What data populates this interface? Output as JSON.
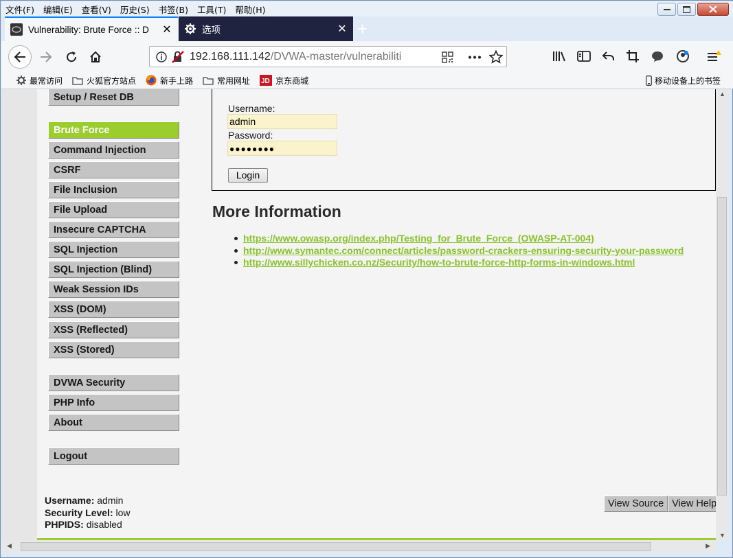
{
  "menubar": {
    "items": [
      "文件(F)",
      "编辑(E)",
      "查看(V)",
      "历史(S)",
      "书签(B)",
      "工具(T)",
      "帮助(H)"
    ]
  },
  "tabs": [
    {
      "label": "Vulnerability: Brute Force :: D",
      "active": true
    },
    {
      "label": "选项",
      "active": false
    }
  ],
  "navbar": {
    "url_host": "192.168.111.142",
    "url_path": "/DVWA-master/vulnerabiliti"
  },
  "bookmarks": {
    "items": [
      "最常访问",
      "火狐官方站点",
      "新手上路",
      "常用网址",
      "京东商城"
    ],
    "right": "移动设备上的书签"
  },
  "sidebar": {
    "top": "Setup / Reset DB",
    "items": [
      "Brute Force",
      "Command Injection",
      "CSRF",
      "File Inclusion",
      "File Upload",
      "Insecure CAPTCHA",
      "SQL Injection",
      "SQL Injection (Blind)",
      "Weak Session IDs",
      "XSS (DOM)",
      "XSS (Reflected)",
      "XSS (Stored)"
    ],
    "selected": "Brute Force",
    "bottom": [
      "DVWA Security",
      "PHP Info",
      "About"
    ],
    "logout": "Logout"
  },
  "login": {
    "username_label": "Username:",
    "username_value": "admin",
    "password_label": "Password:",
    "password_value": "●●●●●●●●",
    "button": "Login"
  },
  "more_info": {
    "title": "More Information",
    "links": [
      "https://www.owasp.org/index.php/Testing_for_Brute_Force_(OWASP-AT-004)",
      "http://www.symantec.com/connect/articles/password-crackers-ensuring-security-your-password",
      "http://www.sillychicken.co.nz/Security/how-to-brute-force-http-forms-in-windows.html"
    ]
  },
  "userinfo": {
    "username_label": "Username:",
    "username_value": "admin",
    "security_label": "Security Level:",
    "security_value": "low",
    "phpids_label": "PHPIDS:",
    "phpids_value": "disabled"
  },
  "footer_buttons": {
    "view_source": "View Source",
    "view_help": "View Help"
  },
  "colors": {
    "accent_green": "#9ccd2e",
    "link_green": "#8ac22b",
    "tab_accent": "#0a84ff"
  }
}
